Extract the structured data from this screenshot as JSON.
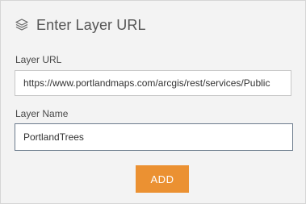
{
  "panel": {
    "title": "Enter Layer URL",
    "icon": "layers-icon"
  },
  "url_field": {
    "label": "Layer URL",
    "value": "https://www.portlandmaps.com/arcgis/rest/services/Public"
  },
  "name_field": {
    "label": "Layer Name",
    "value": "PortlandTrees"
  },
  "add_button": {
    "label": "ADD"
  },
  "colors": {
    "accent": "#eb9132",
    "panel_bg": "#f3f3f3"
  }
}
